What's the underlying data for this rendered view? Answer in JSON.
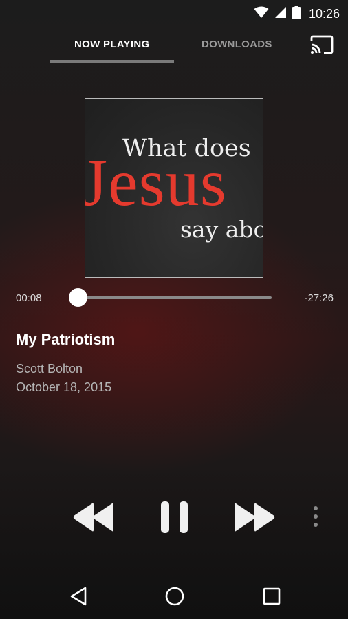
{
  "status_bar": {
    "time": "10:26"
  },
  "tabs": {
    "now_playing": "NOW PLAYING",
    "downloads": "DOWNLOADS"
  },
  "artwork": {
    "line1": "What does",
    "line2": "Jesus",
    "line3": "say abo"
  },
  "player": {
    "elapsed": "00:08",
    "remaining": "-27:26",
    "progress_fraction": 0.005,
    "title": "My Patriotism",
    "speaker": "Scott Bolton",
    "date": "October 18, 2015"
  },
  "colors": {
    "accent_red": "#e53a2e",
    "indicator": "#7a7a7a"
  },
  "icons": [
    "wifi-icon",
    "signal-icon",
    "battery-icon",
    "cast-icon",
    "rewind-icon",
    "pause-icon",
    "fast-forward-icon",
    "more-vert-icon",
    "back-icon",
    "home-icon",
    "recents-icon"
  ]
}
